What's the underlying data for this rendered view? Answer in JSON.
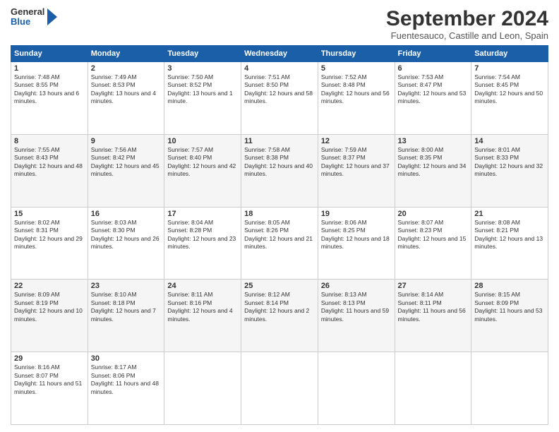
{
  "logo": {
    "line1": "General",
    "line2": "Blue"
  },
  "title": "September 2024",
  "subtitle": "Fuentesauco, Castille and Leon, Spain",
  "header": {
    "days": [
      "Sunday",
      "Monday",
      "Tuesday",
      "Wednesday",
      "Thursday",
      "Friday",
      "Saturday"
    ]
  },
  "weeks": [
    [
      {
        "day": "1",
        "sunrise": "7:48 AM",
        "sunset": "8:55 PM",
        "daylight": "13 hours and 6 minutes."
      },
      {
        "day": "2",
        "sunrise": "7:49 AM",
        "sunset": "8:53 PM",
        "daylight": "13 hours and 4 minutes."
      },
      {
        "day": "3",
        "sunrise": "7:50 AM",
        "sunset": "8:52 PM",
        "daylight": "13 hours and 1 minute."
      },
      {
        "day": "4",
        "sunrise": "7:51 AM",
        "sunset": "8:50 PM",
        "daylight": "12 hours and 58 minutes."
      },
      {
        "day": "5",
        "sunrise": "7:52 AM",
        "sunset": "8:48 PM",
        "daylight": "12 hours and 56 minutes."
      },
      {
        "day": "6",
        "sunrise": "7:53 AM",
        "sunset": "8:47 PM",
        "daylight": "12 hours and 53 minutes."
      },
      {
        "day": "7",
        "sunrise": "7:54 AM",
        "sunset": "8:45 PM",
        "daylight": "12 hours and 50 minutes."
      }
    ],
    [
      {
        "day": "8",
        "sunrise": "7:55 AM",
        "sunset": "8:43 PM",
        "daylight": "12 hours and 48 minutes."
      },
      {
        "day": "9",
        "sunrise": "7:56 AM",
        "sunset": "8:42 PM",
        "daylight": "12 hours and 45 minutes."
      },
      {
        "day": "10",
        "sunrise": "7:57 AM",
        "sunset": "8:40 PM",
        "daylight": "12 hours and 42 minutes."
      },
      {
        "day": "11",
        "sunrise": "7:58 AM",
        "sunset": "8:38 PM",
        "daylight": "12 hours and 40 minutes."
      },
      {
        "day": "12",
        "sunrise": "7:59 AM",
        "sunset": "8:37 PM",
        "daylight": "12 hours and 37 minutes."
      },
      {
        "day": "13",
        "sunrise": "8:00 AM",
        "sunset": "8:35 PM",
        "daylight": "12 hours and 34 minutes."
      },
      {
        "day": "14",
        "sunrise": "8:01 AM",
        "sunset": "8:33 PM",
        "daylight": "12 hours and 32 minutes."
      }
    ],
    [
      {
        "day": "15",
        "sunrise": "8:02 AM",
        "sunset": "8:31 PM",
        "daylight": "12 hours and 29 minutes."
      },
      {
        "day": "16",
        "sunrise": "8:03 AM",
        "sunset": "8:30 PM",
        "daylight": "12 hours and 26 minutes."
      },
      {
        "day": "17",
        "sunrise": "8:04 AM",
        "sunset": "8:28 PM",
        "daylight": "12 hours and 23 minutes."
      },
      {
        "day": "18",
        "sunrise": "8:05 AM",
        "sunset": "8:26 PM",
        "daylight": "12 hours and 21 minutes."
      },
      {
        "day": "19",
        "sunrise": "8:06 AM",
        "sunset": "8:25 PM",
        "daylight": "12 hours and 18 minutes."
      },
      {
        "day": "20",
        "sunrise": "8:07 AM",
        "sunset": "8:23 PM",
        "daylight": "12 hours and 15 minutes."
      },
      {
        "day": "21",
        "sunrise": "8:08 AM",
        "sunset": "8:21 PM",
        "daylight": "12 hours and 13 minutes."
      }
    ],
    [
      {
        "day": "22",
        "sunrise": "8:09 AM",
        "sunset": "8:19 PM",
        "daylight": "12 hours and 10 minutes."
      },
      {
        "day": "23",
        "sunrise": "8:10 AM",
        "sunset": "8:18 PM",
        "daylight": "12 hours and 7 minutes."
      },
      {
        "day": "24",
        "sunrise": "8:11 AM",
        "sunset": "8:16 PM",
        "daylight": "12 hours and 4 minutes."
      },
      {
        "day": "25",
        "sunrise": "8:12 AM",
        "sunset": "8:14 PM",
        "daylight": "12 hours and 2 minutes."
      },
      {
        "day": "26",
        "sunrise": "8:13 AM",
        "sunset": "8:13 PM",
        "daylight": "11 hours and 59 minutes."
      },
      {
        "day": "27",
        "sunrise": "8:14 AM",
        "sunset": "8:11 PM",
        "daylight": "11 hours and 56 minutes."
      },
      {
        "day": "28",
        "sunrise": "8:15 AM",
        "sunset": "8:09 PM",
        "daylight": "11 hours and 53 minutes."
      }
    ],
    [
      {
        "day": "29",
        "sunrise": "8:16 AM",
        "sunset": "8:07 PM",
        "daylight": "11 hours and 51 minutes."
      },
      {
        "day": "30",
        "sunrise": "8:17 AM",
        "sunset": "8:06 PM",
        "daylight": "11 hours and 48 minutes."
      },
      null,
      null,
      null,
      null,
      null
    ]
  ]
}
